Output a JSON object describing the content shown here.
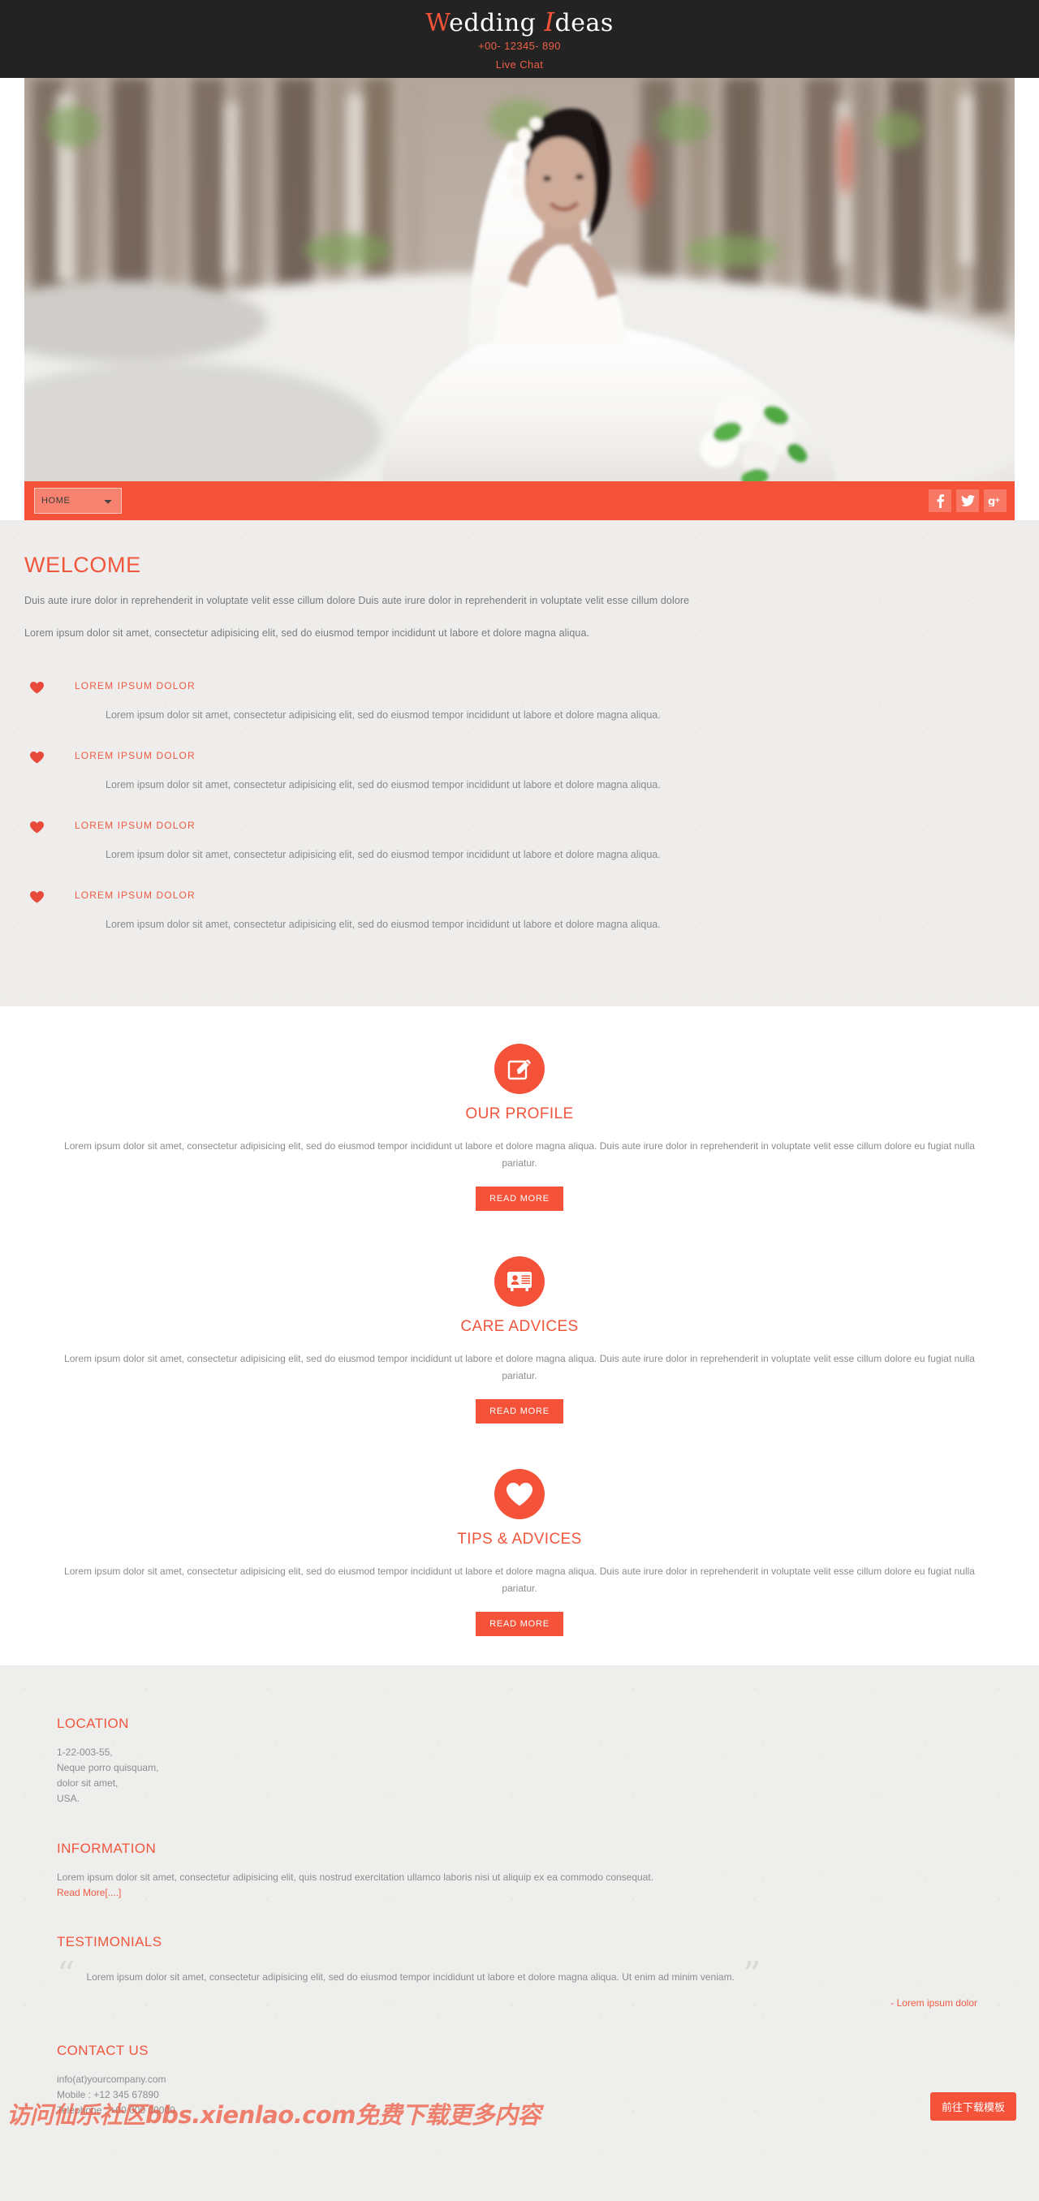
{
  "header": {
    "logo_part1": "W",
    "logo_part2": "edding ",
    "logo_script": "I",
    "logo_part3": "deas",
    "phone": "+00- 12345- 890",
    "live_chat": "Live Chat"
  },
  "nav": {
    "selected": "HOME",
    "options": [
      "HOME"
    ],
    "socials": [
      {
        "name": "facebook-icon",
        "glyph": "f"
      },
      {
        "name": "twitter-icon",
        "glyph": "t"
      },
      {
        "name": "googleplus-icon",
        "glyph": "g+"
      }
    ]
  },
  "welcome": {
    "title": "WELCOME",
    "paragraph1": "Duis aute irure dolor in reprehenderit in voluptate velit esse cillum dolore Duis aute irure dolor in reprehenderit in voluptate velit esse cillum dolore",
    "paragraph2": "Lorem ipsum dolor sit amet, consectetur adipisicing elit, sed do eiusmod tempor incididunt ut labore et dolore magna aliqua.",
    "features": [
      {
        "title": "LOREM IPSUM DOLOR",
        "text": "Lorem ipsum dolor sit amet, consectetur adipisicing elit, sed do eiusmod tempor incididunt ut labore et dolore magna aliqua."
      },
      {
        "title": "LOREM IPSUM DOLOR",
        "text": "Lorem ipsum dolor sit amet, consectetur adipisicing elit, sed do eiusmod tempor incididunt ut labore et dolore magna aliqua."
      },
      {
        "title": "LOREM IPSUM DOLOR",
        "text": "Lorem ipsum dolor sit amet, consectetur adipisicing elit, sed do eiusmod tempor incididunt ut labore et dolore magna aliqua."
      },
      {
        "title": "LOREM IPSUM DOLOR",
        "text": "Lorem ipsum dolor sit amet, consectetur adipisicing elit, sed do eiusmod tempor incididunt ut labore et dolore magna aliqua."
      }
    ]
  },
  "services": [
    {
      "icon": "edit-pencil-icon",
      "name": "OUR PROFILE",
      "text": "Lorem ipsum dolor sit amet, consectetur adipisicing elit, sed do eiusmod tempor incididunt ut labore et dolore magna aliqua.  Duis aute irure dolor in reprehenderit in voluptate velit esse cillum dolore eu fugiat nulla pariatur.",
      "button": "READ MORE"
    },
    {
      "icon": "contact-card-icon",
      "name": "CARE ADVICES",
      "text": "Lorem ipsum dolor sit amet, consectetur adipisicing elit, sed do eiusmod tempor incididunt ut labore et dolore magna aliqua.  Duis aute irure dolor in reprehenderit in voluptate velit esse cillum dolore eu fugiat nulla pariatur.",
      "button": "READ MORE"
    },
    {
      "icon": "heart-icon",
      "name": "TIPS & ADVICES",
      "text": "Lorem ipsum dolor sit amet, consectetur adipisicing elit, sed do eiusmod tempor incididunt ut labore et dolore magna aliqua.  Duis aute irure dolor in reprehenderit in voluptate velit esse cillum dolore eu fugiat nulla pariatur.",
      "button": "READ MORE"
    }
  ],
  "footer": {
    "location": {
      "title": "LOCATION",
      "line1": "1-22-003-55,",
      "line2": "Neque porro quisquam,",
      "line3": "dolor sit amet,",
      "line4": "USA."
    },
    "information": {
      "title": "INFORMATION",
      "text": "Lorem ipsum dolor sit amet, consectetur adipisicing elit, quis nostrud exercitation ullamco laboris nisi ut aliquip ex ea commodo consequat.",
      "read_more": "Read More[....]"
    },
    "testimonials": {
      "title": "TESTIMONIALS",
      "quote": "Lorem ipsum dolor sit amet, consectetur adipisicing elit, sed do eiusmod tempor incididunt ut labore et dolore magna aliqua. Ut enim ad minim veniam.",
      "author": "- Lorem ipsum dolor",
      "open_quote": "“",
      "close_quote": "”"
    },
    "contact": {
      "title": "CONTACT US",
      "email": "info(at)yourcompany.com",
      "mobile": "Mobile : +12 345 67890",
      "telephone": "Telephone : +00 000 00000"
    }
  },
  "overlay": {
    "watermark": "访问仙乐社区bbs.xienlao.com免费下载更多内容",
    "download_button": "前往下载模板"
  },
  "colors": {
    "accent": "#f4533a",
    "accent_text": "#f1563d",
    "dark_header": "#232323",
    "body_bg": "#eeedeb",
    "footer_bg": "#eeeeec",
    "muted_text": "#8a8a8a"
  }
}
